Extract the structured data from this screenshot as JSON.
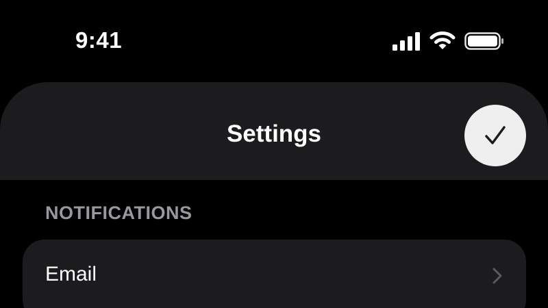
{
  "status_bar": {
    "time": "9:41",
    "icons": [
      "cellular-signal-icon",
      "wifi-icon",
      "battery-icon"
    ]
  },
  "header": {
    "title": "Settings",
    "done_icon": "checkmark-icon"
  },
  "sections": [
    {
      "title": "NOTIFICATIONS",
      "items": [
        {
          "label": "Email",
          "icon": "chevron-right-icon"
        }
      ]
    }
  ],
  "colors": {
    "background": "#000000",
    "surface": "#1c1c1e",
    "section_title": "#98989e",
    "done_button_bg": "#efeff0",
    "chevron": "#5a5a5f"
  }
}
